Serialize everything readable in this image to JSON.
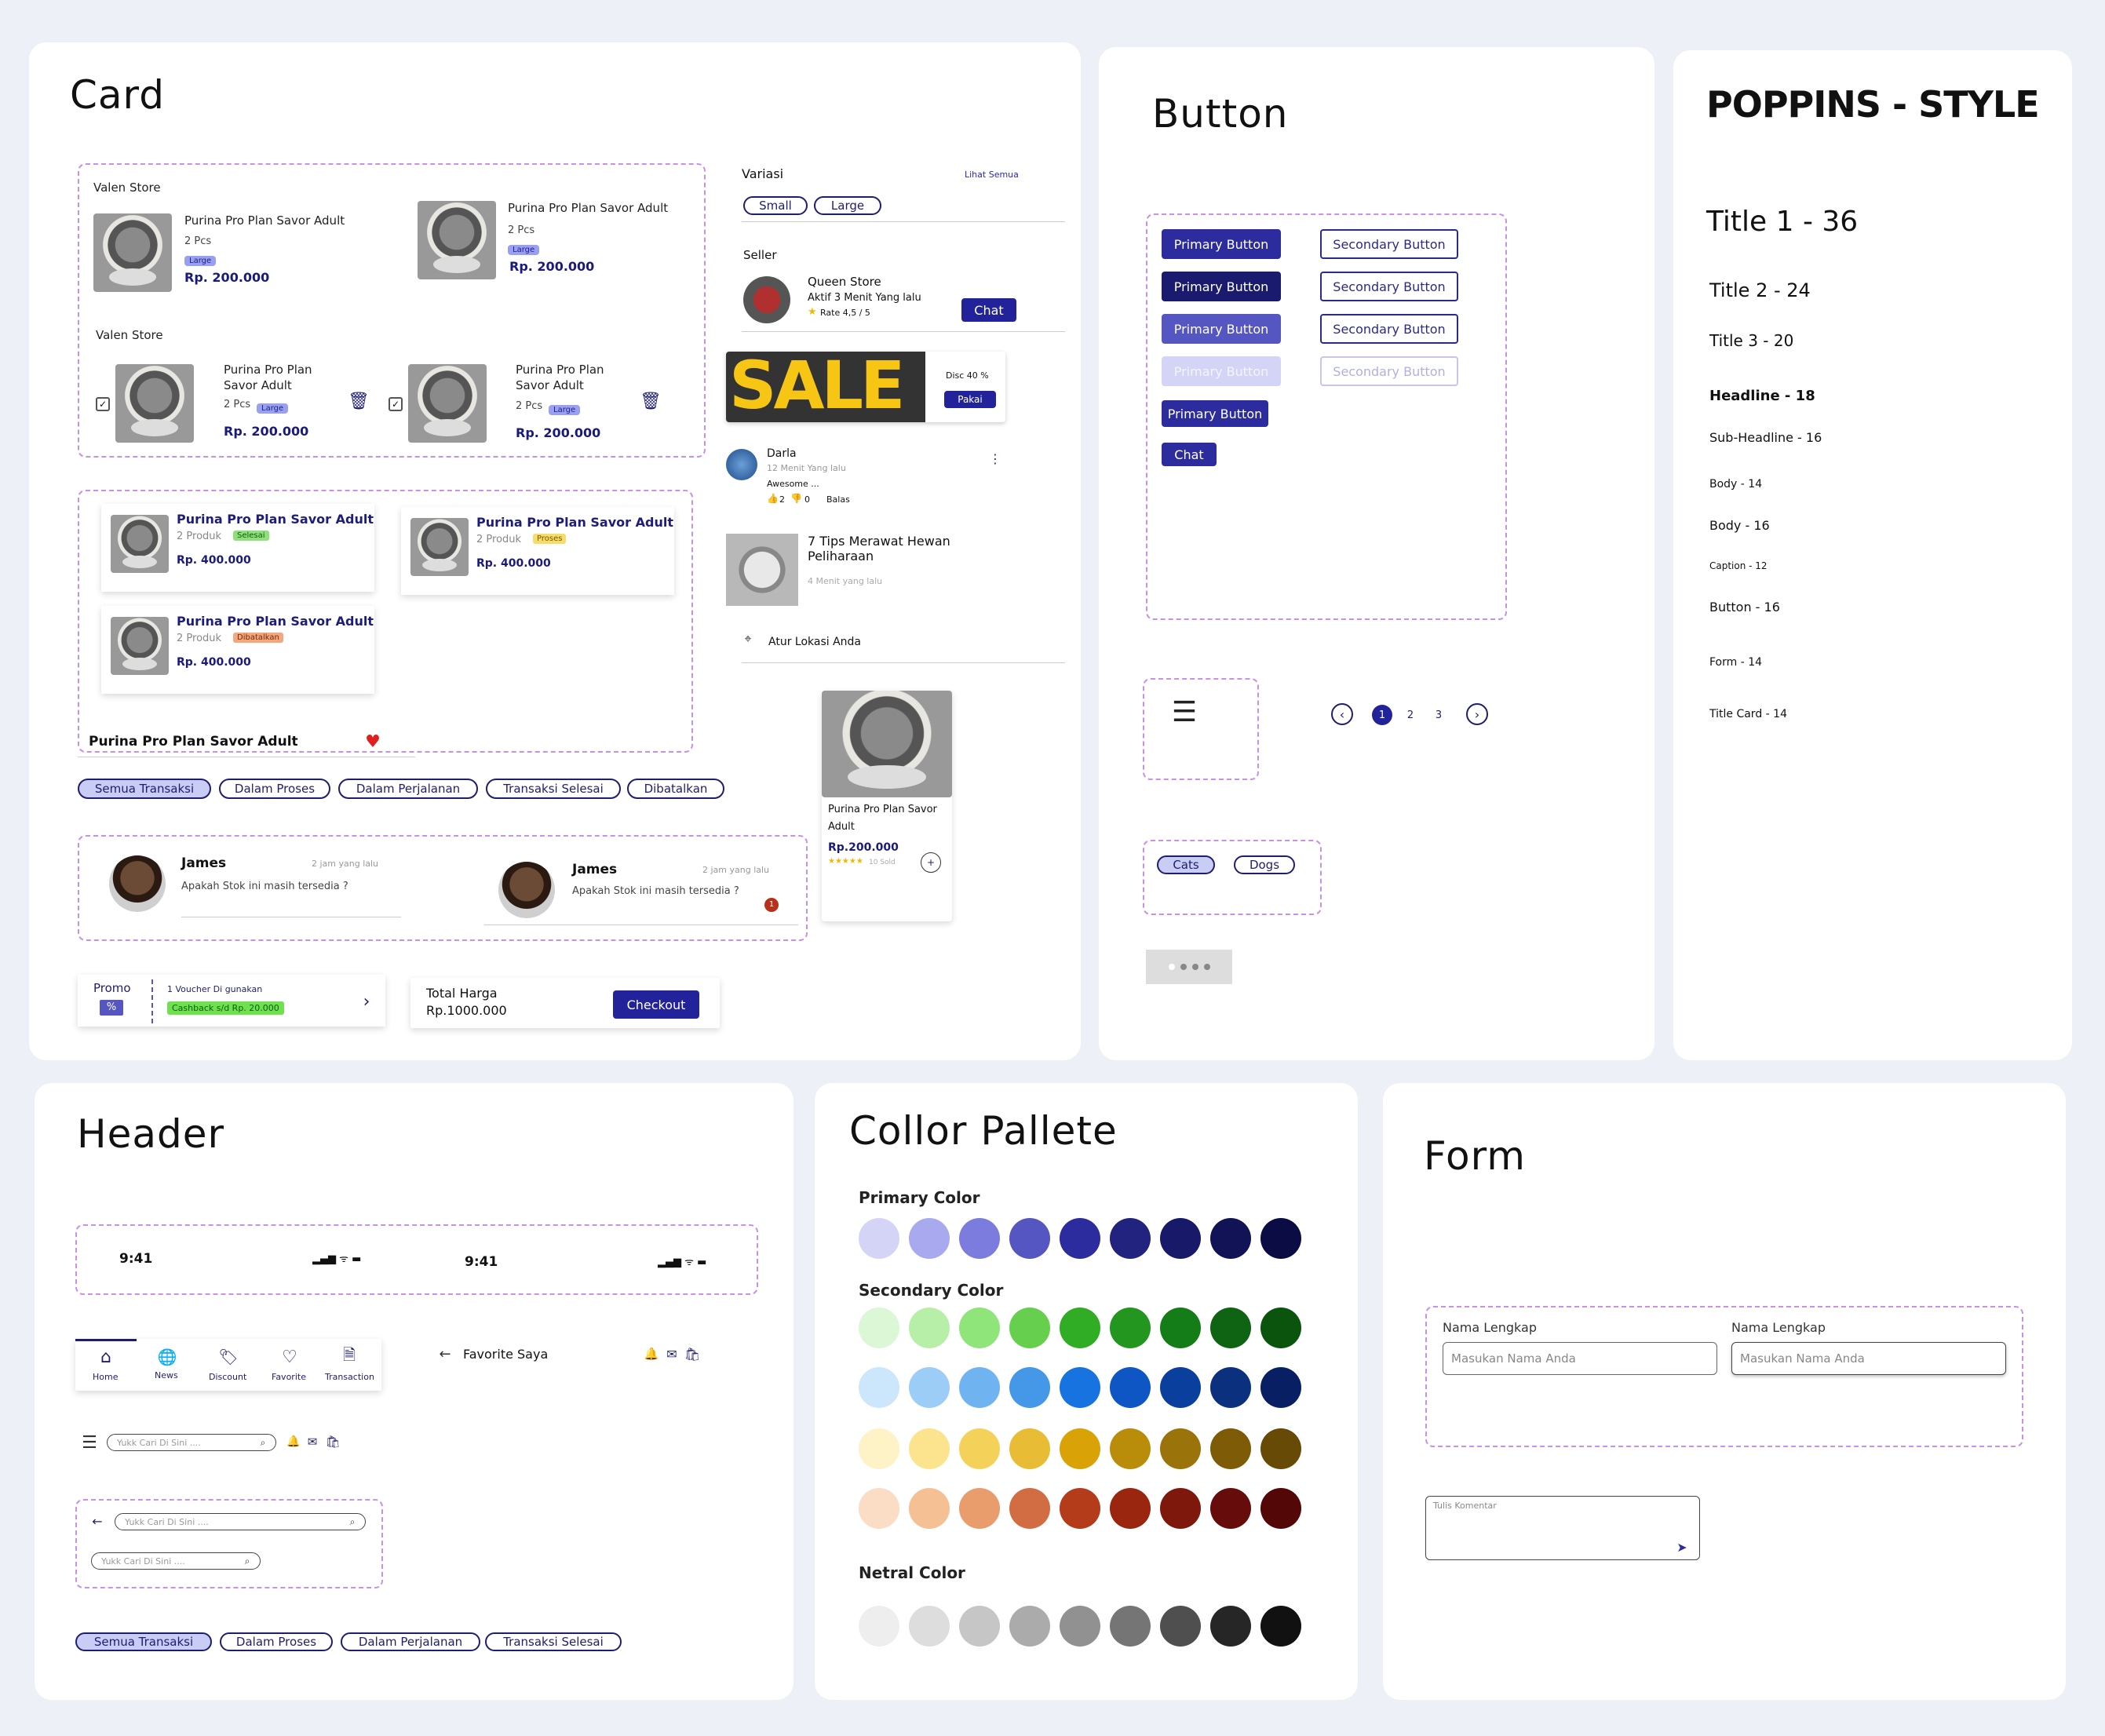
{
  "card": {
    "title": "Card",
    "store1": "Valen Store",
    "store2": "Valen Store",
    "product": "Purina Pro Plan Savor Adult",
    "product_a": "Purina Pro Plan",
    "product_b": "Savor Adult",
    "qty": "2 Pcs",
    "size": "Large",
    "price": "Rp. 200.000",
    "variasi": "Variasi",
    "lihat": "Lihat Semua",
    "small": "Small",
    "large": "Large",
    "seller": "Seller",
    "seller_name": "Queen Store",
    "seller_active": "Aktif 3 Menit Yang lalu",
    "seller_rate": "Rate 4,5 / 5",
    "chat": "Chat",
    "sale_text": "SALE",
    "disc": "Disc 40 %",
    "pakai": "Pakai",
    "comment_name": "Darla",
    "comment_time": "12 Menit Yang lalu",
    "comment_text": "Awesome ...",
    "likes": "2",
    "dislikes": "0",
    "reply": "Balas",
    "article_title": "7 Tips Merawat  Hewan Peliharaan",
    "article_time": "4 Menit yang lalu",
    "location": "Atur Lokasi Anda",
    "order_qty": "2 Produk",
    "order_price": "Rp. 400.000",
    "status_done": "Selesai",
    "status_proc": "Proses",
    "status_cancel": "Dibatalkan",
    "grid_name_a": "Purina Pro Plan Savor",
    "grid_name_b": "Adult",
    "grid_price": "Rp.200.000",
    "grid_sold": "10 Sold",
    "fav_name": "Purina Pro Plan Savor Adult",
    "tabs": [
      "Semua Transaksi",
      "Dalam Proses",
      "Dalam Perjalanan",
      "Transaksi Selesai",
      "Dibatalkan"
    ],
    "chat_name": "James",
    "chat_time": "2 jam yang lalu",
    "chat_msg": "Apakah Stok ini masih tersedia ?",
    "chat_unread": "1",
    "promo": "Promo",
    "promo_voucher": "1 Voucher Di gunakan",
    "promo_cashback": "Cashback s/d Rp. 20.000",
    "total_label": "Total Harga",
    "total_value": "Rp.1000.000",
    "checkout": "Checkout"
  },
  "button": {
    "title": "Button",
    "primary": "Primary Button",
    "secondary": "Secondary Button",
    "chat": "Chat",
    "pages": [
      "1",
      "2",
      "3"
    ],
    "cats": "Cats",
    "dogs": "Dogs"
  },
  "style": {
    "title": "POPPINS - STYLE",
    "items": [
      "Title 1 - 36",
      "Title 2 - 24",
      "Title 3 - 20",
      "Headline - 18",
      "Sub-Headline - 16",
      "Body - 14",
      "Body - 16",
      "Caption - 12",
      "Button - 16",
      "Form - 14",
      "Title Card - 14"
    ]
  },
  "header": {
    "title": "Header",
    "time": "9:41",
    "nav": [
      "Home",
      "News",
      "Discount",
      "Favorite",
      "Transaction"
    ],
    "favorite": "Favorite Saya",
    "search": "Yukk Cari Di Sini ....",
    "search2": "Yukk Cari Di Sini ....",
    "tabs": [
      "Semua Transaksi",
      "Dalam Proses",
      "Dalam Perjalanan",
      "Transaksi Selesai"
    ]
  },
  "palette": {
    "title": "Collor Pallete",
    "primary": "Primary Color",
    "secondary": "Secondary Color",
    "neutral": "Netral Color",
    "primary_colors": [
      "#d4d4f7",
      "#a9a9f0",
      "#7c7cdf",
      "#5656c2",
      "#2c2c9e",
      "#22227f",
      "#19196a",
      "#121256",
      "#0c0c45"
    ],
    "green": [
      "#dcf7d6",
      "#b7efa9",
      "#8fe47a",
      "#66cf4e",
      "#31ad25",
      "#22961e",
      "#157d17",
      "#0e6412",
      "#0b540e"
    ],
    "blue": [
      "#cce6fb",
      "#9ccdf7",
      "#6fb3f1",
      "#4597e8",
      "#1773e0",
      "#0d56c4",
      "#0a3f9e",
      "#0a307e",
      "#091f63"
    ],
    "yellow": [
      "#fdf3c6",
      "#fbe48d",
      "#f4d25a",
      "#e8bd35",
      "#d9a307",
      "#b98c0a",
      "#9a740a",
      "#7e5c07",
      "#674a05"
    ],
    "orange": [
      "#fbdcc4",
      "#f6c095",
      "#e99c6c",
      "#d26c43",
      "#b53c1b",
      "#9a260f",
      "#7e180d",
      "#660c0a",
      "#530707"
    ],
    "neutral_colors": [
      "#eeeeee",
      "#dddddd",
      "#c6c6c6",
      "#ababab",
      "#919191",
      "#757575",
      "#4f4f4f",
      "#262626",
      "#111111"
    ]
  },
  "form": {
    "title": "Form",
    "label": "Nama Lengkap",
    "placeholder": "Masukan Nama Anda",
    "comment": "Tulis Komentar"
  }
}
